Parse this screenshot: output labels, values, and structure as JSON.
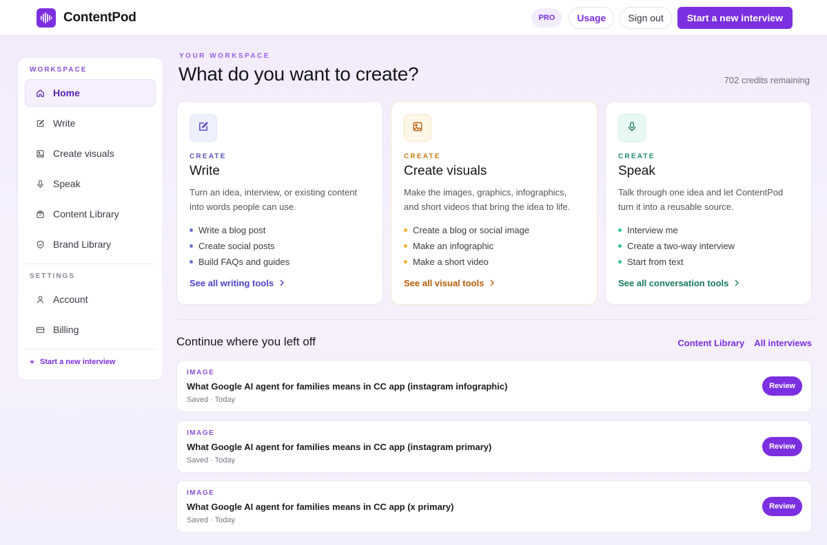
{
  "header": {
    "brand": "ContentPod",
    "pro_badge": "PRO",
    "usage_label": "Usage",
    "signout_label": "Sign out",
    "cta_label": "Start a new interview"
  },
  "sidebar": {
    "workspace_heading": "WORKSPACE",
    "items": [
      {
        "label": "Home",
        "icon": "home-icon"
      },
      {
        "label": "Write",
        "icon": "edit-icon"
      },
      {
        "label": "Create visuals",
        "icon": "image-icon"
      },
      {
        "label": "Speak",
        "icon": "microphone-icon"
      },
      {
        "label": "Content Library",
        "icon": "archive-icon"
      },
      {
        "label": "Brand Library",
        "icon": "shield-icon"
      }
    ],
    "settings_heading": "SETTINGS",
    "settings_items": [
      {
        "label": "Account",
        "icon": "user-icon"
      },
      {
        "label": "Billing",
        "icon": "credit-card-icon"
      }
    ],
    "new_interview": "Start a new interview"
  },
  "main": {
    "kicker": "YOUR WORKSPACE",
    "title": "What do you want to create?",
    "credits": "702 credits remaining",
    "cards": [
      {
        "eyebrow": "CREATE",
        "title": "Write",
        "desc_line1": "Turn an idea, interview, or existing content",
        "desc_line2": "into words people can use.",
        "items": [
          "Write a blog post",
          "Create social posts",
          "Build FAQs and guides"
        ],
        "link": "See all writing tools",
        "accent": "#4b3fc9",
        "eyebrow_color": "#5a52b8",
        "tile_bg": "#eef0fd",
        "dot": "#6b6fcf"
      },
      {
        "eyebrow": "CREATE",
        "title": "Create visuals",
        "desc_line1": "Make the images, graphics, infographics,",
        "desc_line2": "and short videos that bring the idea to life.",
        "items": [
          "Create a blog or social image",
          "Make an infographic",
          "Make a short video"
        ],
        "link": "See all visual tools",
        "accent": "#b85c08",
        "eyebrow_color": "#c77a12",
        "tile_bg": "#fef6e6",
        "dot": "#f0b332"
      },
      {
        "eyebrow": "CREATE",
        "title": "Speak",
        "desc_line1": "Talk through one idea and let ContentPod",
        "desc_line2": "turn it into a reusable source.",
        "items": [
          "Interview me",
          "Create a two-way interview",
          "Start from text"
        ],
        "link": "See all conversation tools",
        "accent": "#157a5c",
        "eyebrow_color": "#1f8a69",
        "tile_bg": "#e9f8f2",
        "dot": "#2fc49a"
      }
    ],
    "continue": {
      "title": "Continue where you left off",
      "link_library": "Content Library",
      "link_interviews": "All interviews",
      "rows": [
        {
          "kind": "IMAGE",
          "title": "What Google AI agent for families means in CC app (instagram infographic)",
          "meta": "Saved · Today",
          "action": "Review"
        },
        {
          "kind": "IMAGE",
          "title": "What Google AI agent for families means in CC app (instagram primary)",
          "meta": "Saved · Today",
          "action": "Review"
        },
        {
          "kind": "IMAGE",
          "title": "What Google AI agent for families means in CC app (x primary)",
          "meta": "Saved · Today",
          "action": "Review"
        }
      ]
    }
  }
}
